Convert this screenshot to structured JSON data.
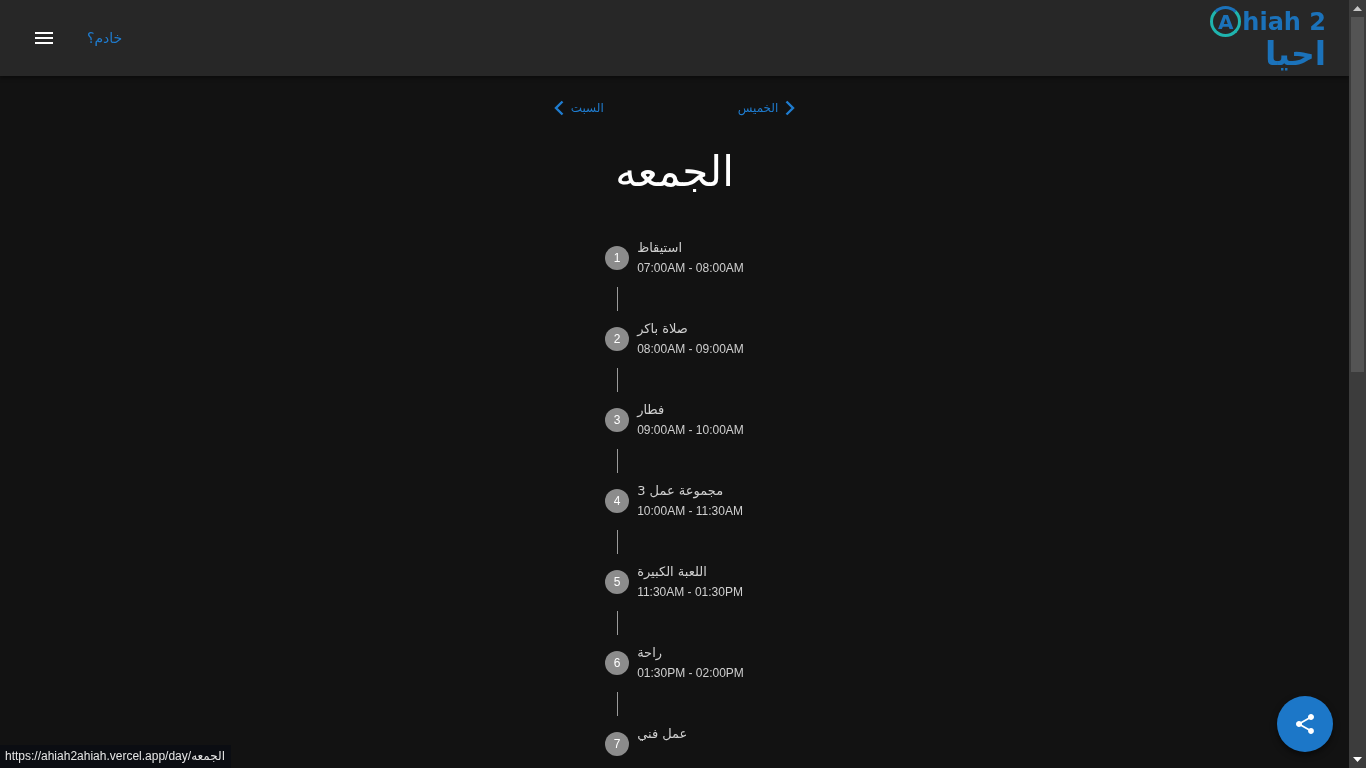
{
  "header": {
    "link": "خادم؟",
    "logo": {
      "initial": "A",
      "latin": "hiah 2",
      "arabic": "احيا"
    }
  },
  "day_nav": [
    {
      "label": "الخميس",
      "kind": "previous"
    },
    {
      "label": "السبت",
      "kind": "next"
    }
  ],
  "day_title": "الجمعه",
  "schedule": [
    {
      "number": "1",
      "title": "استيقاظ",
      "time": "07:00AM - 08:00AM"
    },
    {
      "number": "2",
      "title": "صلاة باكر",
      "time": "08:00AM - 09:00AM"
    },
    {
      "number": "3",
      "title": "فطار",
      "time": "09:00AM - 10:00AM"
    },
    {
      "number": "4",
      "title": "مجموعة عمل 3",
      "time": "10:00AM - 11:30AM"
    },
    {
      "number": "5",
      "title": "اللعبة الكبيرة",
      "time": "11:30AM - 01:30PM"
    },
    {
      "number": "6",
      "title": "راحة",
      "time": "01:30PM - 02:00PM"
    },
    {
      "number": "7",
      "title": "عمل فني"
    }
  ],
  "status_bar": {
    "url": "https://ahiah2ahiah.vercel.app/day/الجمعه"
  }
}
